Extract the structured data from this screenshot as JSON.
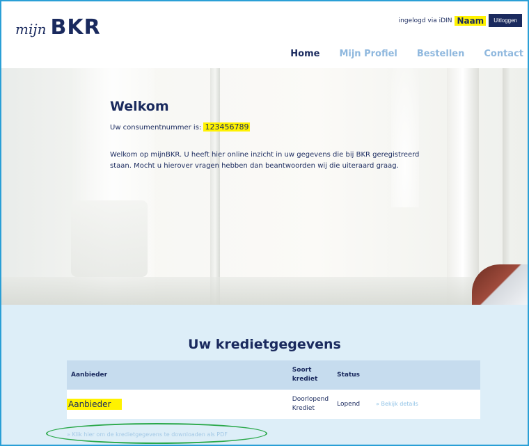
{
  "header": {
    "logo_script": "mijn",
    "logo_brand": "BKR",
    "login_status": "ingelogd via iDIN",
    "user_name": "Naam",
    "logout_label": "Uitloggen"
  },
  "nav": {
    "items": [
      {
        "label": "Home",
        "active": true
      },
      {
        "label": "Mijn Profiel",
        "active": false
      },
      {
        "label": "Bestellen",
        "active": false
      },
      {
        "label": "Contact",
        "active": false
      }
    ]
  },
  "welcome": {
    "title": "Welkom",
    "consumer_label": "Uw consumentnummer is:",
    "consumer_number": "123456789",
    "intro_line1": "Welkom op mijnBKR. U heeft hier online inzicht in uw gegevens die bij BKR geregistreerd",
    "intro_line2": "staan. Mocht u hierover vragen hebben dan beantwoorden wij die uiteraard graag."
  },
  "credit": {
    "title": "Uw kredietgegevens",
    "columns": {
      "provider": "Aanbieder",
      "type_line1": "Soort",
      "type_line2": "krediet",
      "status": "Status"
    },
    "rows": [
      {
        "provider": "Aanbieder",
        "type_line1": "Doorlopend",
        "type_line2": "Krediet",
        "status": "Lopend",
        "detail_link": "» Bekijk details"
      }
    ],
    "pdf_link": "» Klik hier om de kredietgegevens te downloaden als PDF"
  },
  "colors": {
    "brand_navy": "#1a2a5e",
    "nav_inactive": "#8fb8de",
    "highlight": "#fff200",
    "section_bg": "#ddeef8",
    "table_header_bg": "#c6dcee",
    "annotation_oval": "#2aa84a",
    "frame_border": "#2a9fd6"
  }
}
